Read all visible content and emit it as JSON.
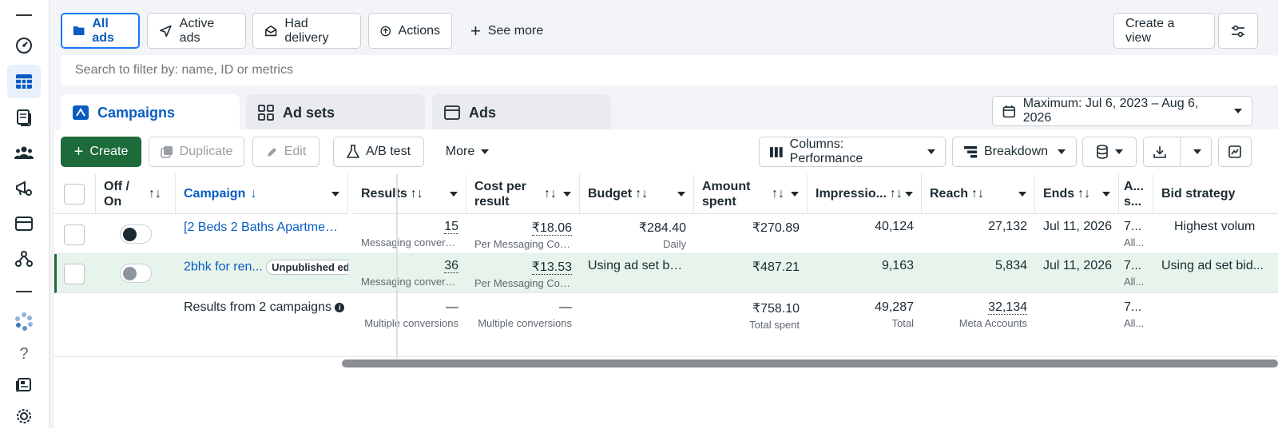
{
  "filters": {
    "all_ads": "All ads",
    "active_ads": "Active ads",
    "had_delivery": "Had delivery",
    "actions": "Actions",
    "see_more": "See more",
    "create_view": "Create a view"
  },
  "search": {
    "placeholder": "Search to filter by: name, ID or metrics"
  },
  "tabs": {
    "campaigns": "Campaigns",
    "ad_sets": "Ad sets",
    "ads": "Ads"
  },
  "date_range": "Maximum: Jul 6, 2023 – Aug 6, 2026",
  "toolbar": {
    "create": "Create",
    "duplicate": "Duplicate",
    "edit": "Edit",
    "ab_test": "A/B test",
    "more": "More",
    "columns": "Columns: Performance",
    "breakdown": "Breakdown"
  },
  "columns": {
    "off_on": "Off / On",
    "campaign": "Campaign",
    "results": "Results",
    "cost_per_result": "Cost per result",
    "budget": "Budget",
    "amount_spent": "Amount spent",
    "impressions": "Impressio...",
    "reach": "Reach",
    "ends": "Ends",
    "attribution": "A... s...",
    "bid_strategy": "Bid strategy"
  },
  "rows": [
    {
      "name": "[2 Beds 2 Baths Apartmen...",
      "badge": "",
      "results": "15",
      "results_sub": "Messaging convers...",
      "cost": "₹18.06",
      "cost_sub": "Per Messaging Con...",
      "budget": "₹284.40",
      "budget_sub": "Daily",
      "spent": "₹270.89",
      "impressions": "40,124",
      "reach": "27,132",
      "ends": "Jul 11, 2026",
      "attr": "7...",
      "attr_sub": "All...",
      "bid": "Highest volum",
      "on": true
    },
    {
      "name": "2bhk for ren...",
      "badge": "Unpublished ed",
      "results": "36",
      "results_sub": "Messaging convers...",
      "cost": "₹13.53",
      "cost_sub": "Per Messaging Con...",
      "budget": "Using ad set bu...",
      "budget_sub": "",
      "spent": "₹487.21",
      "impressions": "9,163",
      "reach": "5,834",
      "ends": "Jul 11, 2026",
      "attr": "7...",
      "attr_sub": "All...",
      "bid": "Using ad set bid...",
      "on": false
    }
  ],
  "summary": {
    "label": "Results from 2 campaigns",
    "results": "—",
    "results_sub": "Multiple conversions",
    "cost": "—",
    "cost_sub": "Multiple conversions",
    "spent": "₹758.10",
    "spent_sub": "Total spent",
    "impressions": "49,287",
    "impressions_sub": "Total",
    "reach": "32,134",
    "reach_sub": "Meta Accounts",
    "attr": "7...",
    "attr_sub": "All..."
  },
  "colors": {
    "accent": "#0a5cc2",
    "create_green": "#1d6b3a",
    "row_highlight": "#e6f4ec"
  }
}
